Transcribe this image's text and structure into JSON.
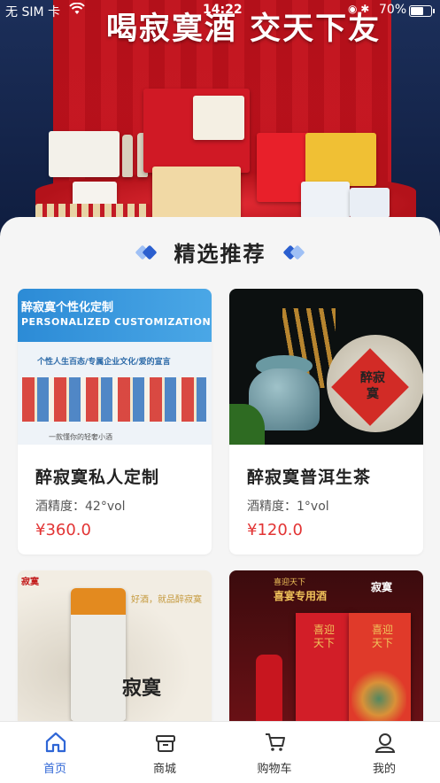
{
  "status_bar": {
    "carrier": "无 SIM 卡",
    "time": "14:22",
    "battery_percent": "70%",
    "battery_level": 0.7
  },
  "banner": {
    "slogan": "喝寂寞酒 交天下友"
  },
  "section": {
    "title": "精选推荐"
  },
  "products": [
    {
      "name": "醉寂寞私人定制",
      "abv": "酒精度：42°vol",
      "price": "¥360.0",
      "image_text": {
        "title": "醉寂寞个性化定制",
        "subtitle": "PERSONALIZED CUSTOMIZATION",
        "tagline": "个性人生百态/专属企业文化/爱的宣言",
        "footer": "一款懂你的轻奢小酒"
      }
    },
    {
      "name": "醉寂寞普洱生茶",
      "abv": "酒精度：1°vol",
      "price": "¥120.0",
      "image_text": {
        "label": "醉寂寞"
      }
    },
    {
      "name": "",
      "abv": "",
      "price": "",
      "image_text": {
        "logo": "寂寞",
        "slogan": "好酒，就品醉寂寞",
        "mark": "寂寞"
      }
    },
    {
      "name": "",
      "abv": "",
      "price": "",
      "image_text": {
        "header_small": "喜迎天下",
        "header_big": "喜宴专用酒",
        "logo": "寂寞",
        "box_text_1": "喜迎天下",
        "box_text_2": "喜迎天下"
      }
    }
  ],
  "tabbar": {
    "items": [
      {
        "label": "首页",
        "icon": "home-icon",
        "active": true
      },
      {
        "label": "商城",
        "icon": "shop-icon",
        "active": false
      },
      {
        "label": "购物车",
        "icon": "cart-icon",
        "active": false
      },
      {
        "label": "我的",
        "icon": "user-icon",
        "active": false
      }
    ],
    "active_color": "#2f66d6",
    "inactive_color": "#333333"
  },
  "colors": {
    "price": "#e23434",
    "accent_blue": "#2b5fcf",
    "banner_red": "#c8141f"
  }
}
